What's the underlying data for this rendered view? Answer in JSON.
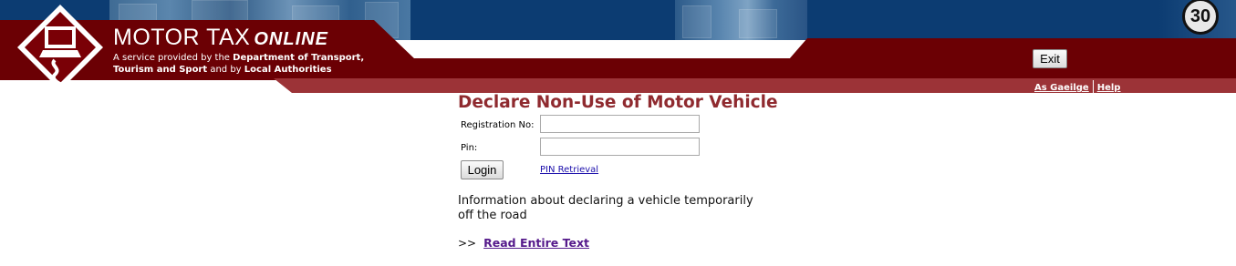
{
  "header": {
    "brand_title": "MOTOR TAX",
    "brand_title_suffix": "ONLINE",
    "subtitle_pre": "A service provided by the ",
    "subtitle_bold1": "Department of Transport, Tourism and Sport",
    "subtitle_mid": " and by ",
    "subtitle_bold2": "Local Authorities",
    "badge_text": "30",
    "exit_label": "Exit",
    "links": [
      "As Gaeilge",
      "Help"
    ]
  },
  "main": {
    "title": "Declare Non-Use of Motor Vehicle",
    "form": {
      "registration_label": "Registration No:",
      "registration_value": "",
      "pin_label": "Pin:",
      "pin_value": "",
      "login_label": "Login",
      "pin_retrieval_label": "PIN Retrieval"
    },
    "info_text": "Information about declaring a vehicle temporarily off the road",
    "read_more_prefix": ">>",
    "read_more_label": "Read Entire Text"
  },
  "colors": {
    "header_blue": "#0c3c72",
    "header_red": "#6b0004",
    "header_red_light": "#9c3337",
    "title_red": "#8f2a2f",
    "link_blue": "#1a0dab",
    "link_visited": "#551a8b"
  },
  "icons": {
    "logo": "computer-monitor-diamond-logo-icon",
    "badge": "anniversary-30-badge-icon"
  }
}
